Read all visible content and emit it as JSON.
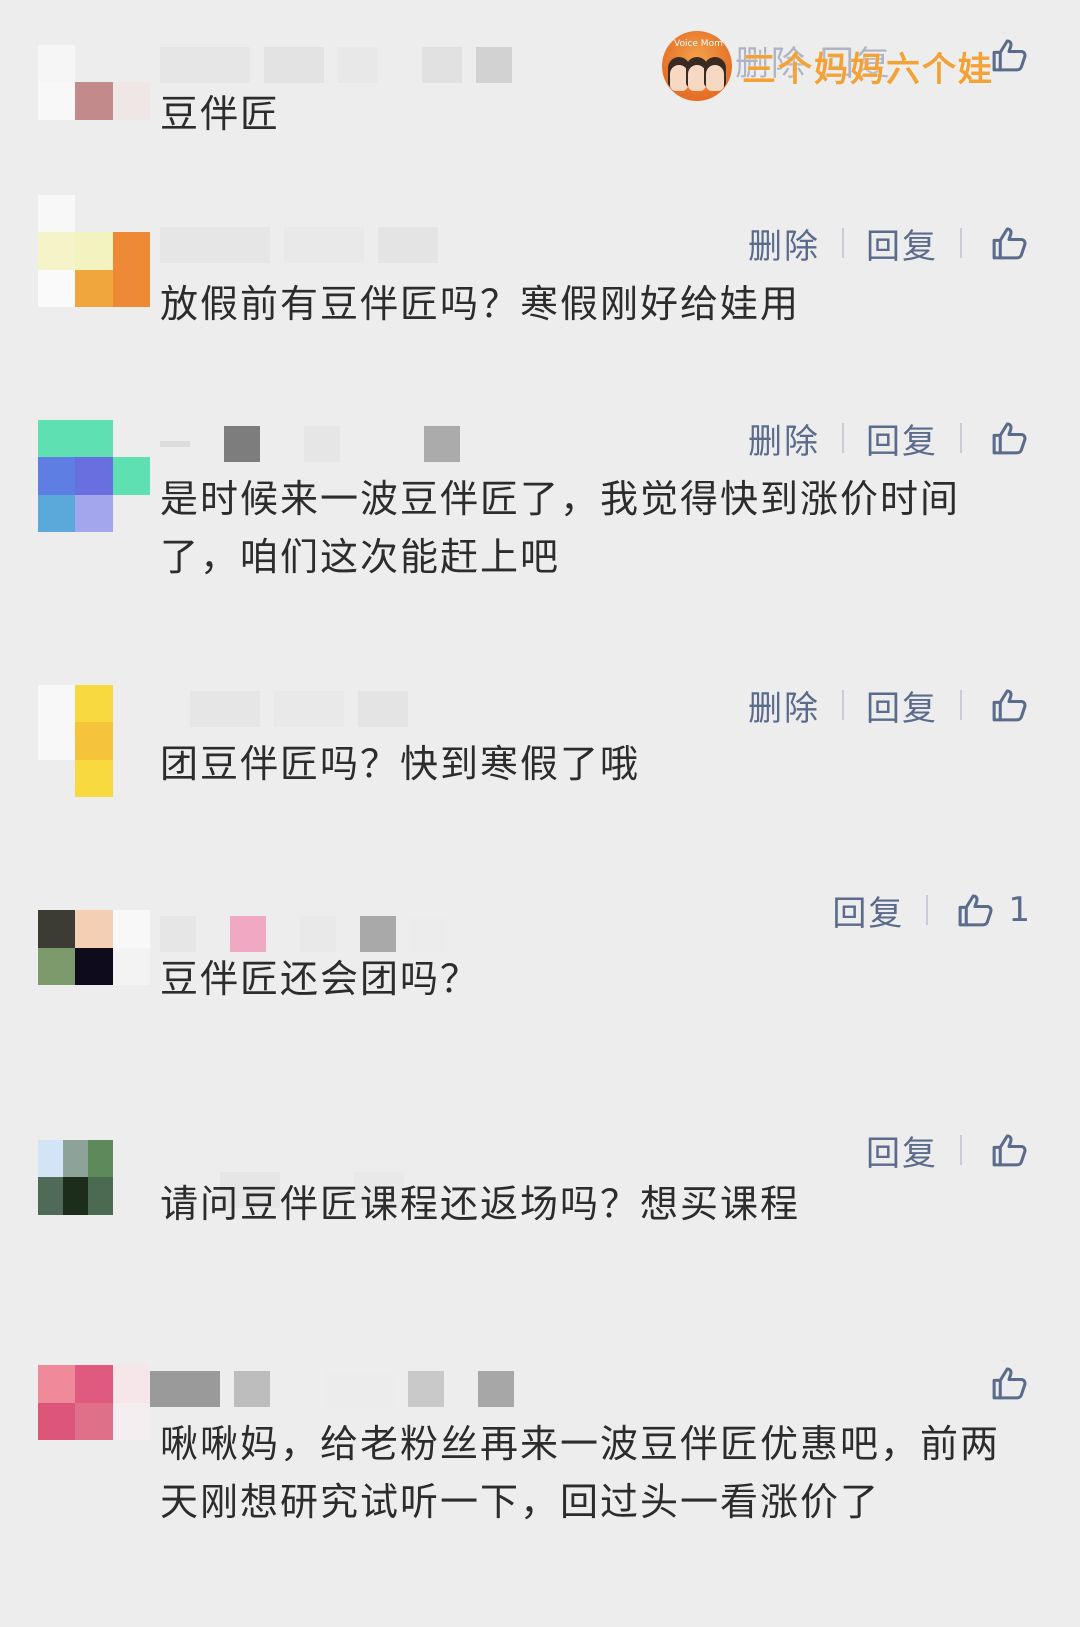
{
  "watermark": {
    "brand_text": "三个妈妈六个娃",
    "logo_caption": "Voice Mom"
  },
  "labels": {
    "delete": "删除",
    "reply": "回复"
  },
  "comments": [
    {
      "text": "豆伴匠",
      "actions": [
        "删除",
        "回复"
      ],
      "likes": ""
    },
    {
      "text": "放假前有豆伴匠吗？寒假刚好给娃用",
      "actions": [
        "删除",
        "回复"
      ],
      "likes": ""
    },
    {
      "text": "是时候来一波豆伴匠了，我觉得快到涨价时间了，咱们这次能赶上吧",
      "actions": [
        "删除",
        "回复"
      ],
      "likes": ""
    },
    {
      "text": "团豆伴匠吗？快到寒假了哦",
      "actions": [
        "删除",
        "回复"
      ],
      "likes": ""
    },
    {
      "text": "豆伴匠还会团吗？",
      "actions": [
        "回复"
      ],
      "likes": "1"
    },
    {
      "text": "请问豆伴匠课程还返场吗？想买课程",
      "actions": [
        "回复"
      ],
      "likes": ""
    },
    {
      "text": "啾啾妈，给老粉丝再来一波豆伴匠优惠吧，前两天刚想研究试听一下，回过头一看涨价了",
      "actions": [],
      "likes": ""
    }
  ],
  "colors": {
    "background": "#ededed",
    "action_text": "#5b6b8c",
    "comment_text": "#2c2c2c",
    "watermark_text": "#f4a237"
  },
  "icons": {
    "like": "thumbs-up-icon"
  }
}
